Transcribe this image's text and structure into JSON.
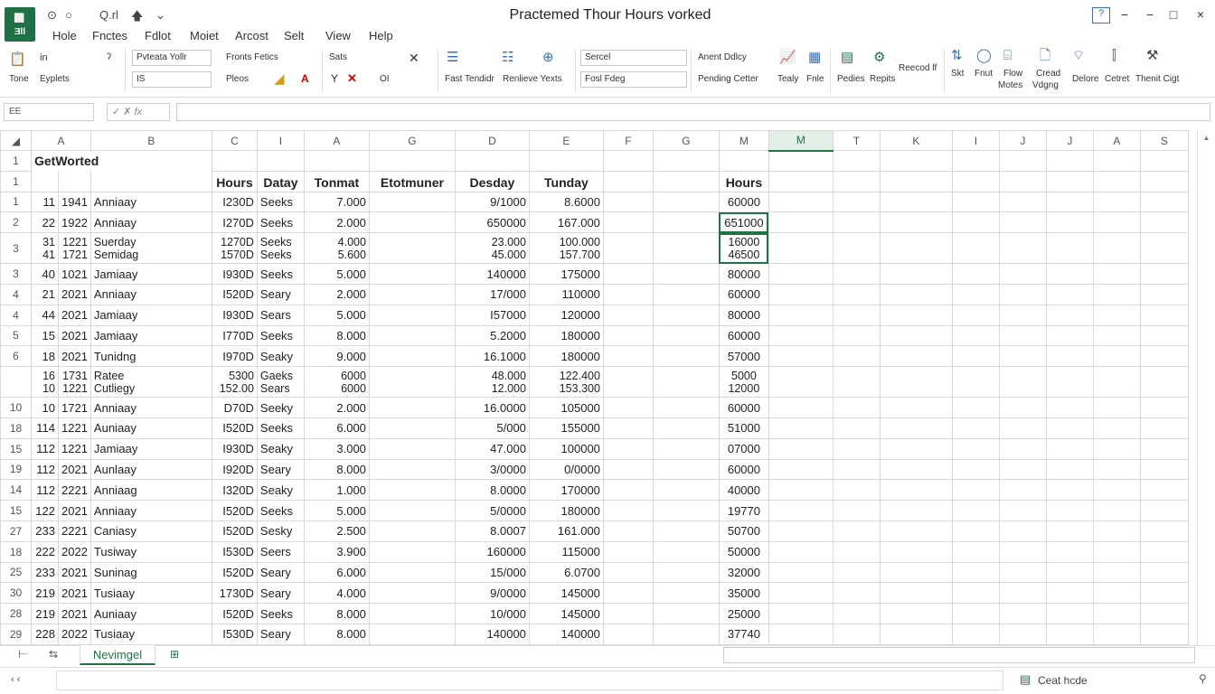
{
  "app": {
    "logo_text": "Ǝll",
    "title": "Practemed Thour Hours vorked"
  },
  "qat": [
    "⊙",
    "○",
    "Q.rl",
    "🡅",
    "⌄"
  ],
  "window": {
    "help_icon": "?",
    "min": "−",
    "restore": "−",
    "max": "□",
    "close": "×"
  },
  "menu": [
    "Hole",
    "Fnctes",
    "Fdlot",
    "Moiet",
    "Arcost",
    "Selt",
    "View",
    "Help"
  ],
  "ribbon": {
    "paste_label": "Tone",
    "paste2": "in",
    "explets": "Eyplets",
    "font_name": "Pvteata Yollr",
    "font_size": "IS",
    "fronts": "Fronts Fetics",
    "place": "Pleos",
    "sats": "Sats",
    "ol": "OI",
    "fast_tendidr": "Fast Tendidr",
    "renlieve": "Renlieve Yexts",
    "format_sel1": "Sercel",
    "format_sel2": "Fosl Fdeg",
    "avent": "Anent Ddlcy",
    "pending": "Pending Cetter",
    "tealy": "Tealy",
    "fnle": "Fnle",
    "pedies": "Pedies",
    "repits": "Repits",
    "reecod": "Reecod lf",
    "skt": "Skt",
    "fnut": "Fnut",
    "flow": "Flow",
    "motes": "Motes",
    "cread": "Cread",
    "viging": "Vdgng",
    "delore": "Delore",
    "cetret": "Cetret",
    "thent": "Thenit Cigt"
  },
  "formula_bar": {
    "namebox": "EE",
    "value": ""
  },
  "columns": [
    "A",
    "B",
    "C",
    "I",
    "A",
    "G",
    "D",
    "E",
    "F",
    "G",
    "M",
    "M",
    "T",
    "K",
    "I",
    "J",
    "J",
    "A",
    "S"
  ],
  "rows": [
    {
      "rh": "1",
      "a": "",
      "b": "",
      "c": "",
      "d": "",
      "e": "",
      "f": "",
      "g": "",
      "h": "",
      "m": "",
      "tall": false,
      "title": "GetWorted"
    },
    {
      "rh": "1",
      "header": true,
      "c": "Hours",
      "d": "Datay",
      "e": "Tonmat",
      "f": "Etotmuner",
      "g": "Desday",
      "h": "Tunday",
      "m": "Hours"
    },
    {
      "rh": "1",
      "a": "11",
      "b": "1941",
      "bb": "Anniaay",
      "c": "I230D",
      "d": "Seeks",
      "e": "7.000",
      "g": "9/1000",
      "h": "8.6000",
      "m": "60000"
    },
    {
      "rh": "2",
      "a": "22",
      "b": "1922",
      "bb": "Anniaay",
      "c": "I270D",
      "d": "Seeks",
      "e": "2.000",
      "g": "650000",
      "h": "167.000",
      "m": "651000",
      "sel": true
    },
    {
      "rh": "3",
      "two": true,
      "a": "31",
      "a2": "41",
      "b": "1221",
      "b2": "1721",
      "bb": "Suerday",
      "bb2": "Semidag",
      "c": "1270D",
      "c2": "1570D",
      "d": "Seeks",
      "d2": "Seeks",
      "e": "4.000",
      "e2": "5.600",
      "g": "23.000",
      "g2": "45.000",
      "h": "100.000",
      "h2": "157.700",
      "m": "16000",
      "m2": "46500",
      "sel": true
    },
    {
      "rh": "3",
      "a": "40",
      "b": "1021",
      "bb": "Jamiaay",
      "c": "I930D",
      "d": "Seeks",
      "e": "5.000",
      "g": "140000",
      "h": "175000",
      "m": "80000"
    },
    {
      "rh": "4",
      "a": "21",
      "b": "2021",
      "bb": "Anniaay",
      "c": "I520D",
      "d": "Seary",
      "e": "2.000",
      "g": "17/000",
      "h": "110000",
      "m": "60000"
    },
    {
      "rh": "4",
      "a": "44",
      "b": "2021",
      "bb": "Jamiaay",
      "c": "I930D",
      "d": "Sears",
      "e": "5.000",
      "g": "I57000",
      "h": "120000",
      "m": "80000"
    },
    {
      "rh": "5",
      "a": "15",
      "b": "2021",
      "bb": "Jamiaay",
      "c": "I770D",
      "d": "Seeks",
      "e": "8.000",
      "g": "5.2000",
      "h": "180000",
      "m": "60000"
    },
    {
      "rh": "6",
      "a": "18",
      "b": "2021",
      "bb": "Tunidng",
      "c": "I970D",
      "d": "Seaky",
      "e": "9.000",
      "g": "16.1000",
      "h": "180000",
      "m": "57000"
    },
    {
      "rh": "",
      "two": true,
      "a": "16",
      "a2": "10",
      "b": "1731",
      "b2": "1221",
      "bb": "Ratee",
      "bb2": "Cutliegy",
      "c": "5300",
      "c2": "152.00",
      "d": "Gaeks",
      "d2": "Sears",
      "e": "6000",
      "e2": "6000",
      "g": "48.000",
      "g2": "12.000",
      "h": "122.400",
      "h2": "153.300",
      "m": "5000",
      "m2": "12000"
    },
    {
      "rh": "10",
      "a": "10",
      "b": "1721",
      "bb": "Anniaay",
      "c": "D70D",
      "d": "Seeky",
      "e": "2.000",
      "g": "16.0000",
      "h": "105000",
      "m": "60000"
    },
    {
      "rh": "18",
      "a": "114",
      "b": "1221",
      "bb": "Auniaay",
      "c": "I520D",
      "d": "Seeks",
      "e": "6.000",
      "g": "5/000",
      "h": "155000",
      "m": "51000"
    },
    {
      "rh": "15",
      "a": "112",
      "b": "1221",
      "bb": "Jamiaay",
      "c": "I930D",
      "d": "Seaky",
      "e": "3.000",
      "g": "47.000",
      "h": "100000",
      "m": "07000"
    },
    {
      "rh": "19",
      "a": "112",
      "b": "2021",
      "bb": "Aunlaay",
      "c": "I920D",
      "d": "Seary",
      "e": "8.000",
      "g": "3/0000",
      "h": "0/0000",
      "m": "60000"
    },
    {
      "rh": "14",
      "a": "112",
      "b": "2221",
      "bb": "Anniaag",
      "c": "I320D",
      "d": "Seaky",
      "e": "1.000",
      "g": "8.0000",
      "h": "170000",
      "m": "40000"
    },
    {
      "rh": "15",
      "a": "122",
      "b": "2021",
      "bb": "Anniaay",
      "c": "I520D",
      "d": "Seeks",
      "e": "5.000",
      "g": "5/0000",
      "h": "180000",
      "m": "19770"
    },
    {
      "rh": "27",
      "a": "233",
      "b": "2221",
      "bb": "Caniasy",
      "c": "I520D",
      "d": "Sesky",
      "e": "2.500",
      "g": "8.0007",
      "h": "161.000",
      "m": "50700"
    },
    {
      "rh": "18",
      "a": "222",
      "b": "2022",
      "bb": "Tusiway",
      "c": "I530D",
      "d": "Seers",
      "e": "3.900",
      "g": "160000",
      "h": "115000",
      "m": "50000"
    },
    {
      "rh": "25",
      "a": "233",
      "b": "2021",
      "bb": "Suninag",
      "c": "I520D",
      "d": "Seary",
      "e": "6.000",
      "g": "15/000",
      "h": "6.0700",
      "m": "32000"
    },
    {
      "rh": "30",
      "a": "219",
      "b": "2021",
      "bb": "Tusiaay",
      "c": "1730D",
      "d": "Seary",
      "e": "4.000",
      "g": "9/0000",
      "h": "145000",
      "m": "35000"
    },
    {
      "rh": "28",
      "a": "219",
      "b": "2021",
      "bb": "Auniaay",
      "c": "I520D",
      "d": "Seeks",
      "e": "8.000",
      "g": "10/000",
      "h": "145000",
      "m": "25000"
    },
    {
      "rh": "29",
      "a": "228",
      "b": "2022",
      "bb": "Tusiaay",
      "c": "I530D",
      "d": "Seary",
      "e": "8.000",
      "g": "140000",
      "h": "140000",
      "m": "37740"
    }
  ],
  "sheet_tab": "Nevimgel",
  "status": {
    "message": "Ceat hcde"
  }
}
